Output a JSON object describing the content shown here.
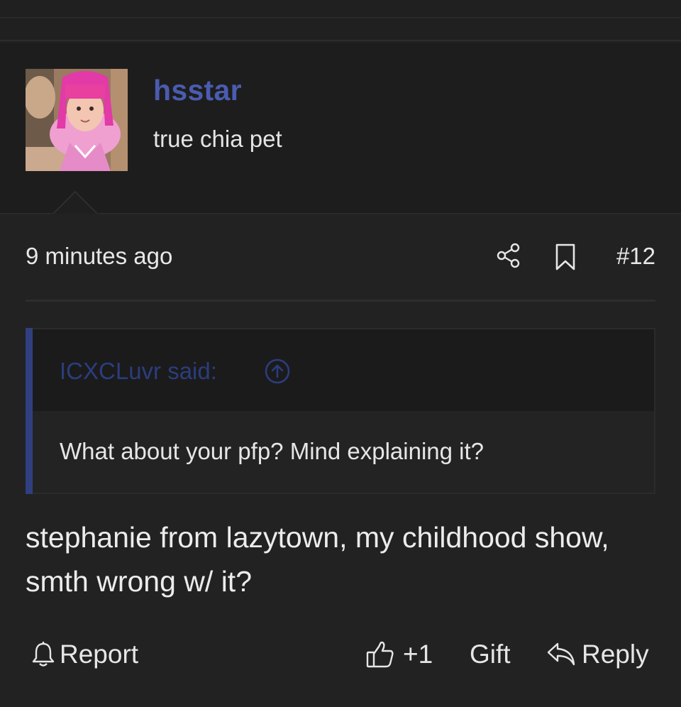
{
  "user": {
    "name": "hsstar",
    "title": "true chia pet"
  },
  "post": {
    "timestamp": "9 minutes ago",
    "number": "#12",
    "quote": {
      "author": "ICXCLuvr said:",
      "text": "What about your pfp? Mind explaining it?"
    },
    "message": "stephanie from lazytown, my childhood show, smth wrong w/ it?"
  },
  "actions": {
    "report": "Report",
    "like": "+1",
    "gift": "Gift",
    "reply": "Reply"
  },
  "icons": {
    "share": "share-icon",
    "bookmark": "bookmark-icon",
    "quote_jump": "arrow-up-circle-icon",
    "report": "bell-icon",
    "like": "thumbs-up-icon",
    "reply": "reply-arrow-icon"
  },
  "colors": {
    "background": "#222222",
    "username": "#4a5cb0",
    "quote_accent": "#2f3f80",
    "quote_author": "#2c3d7e"
  }
}
